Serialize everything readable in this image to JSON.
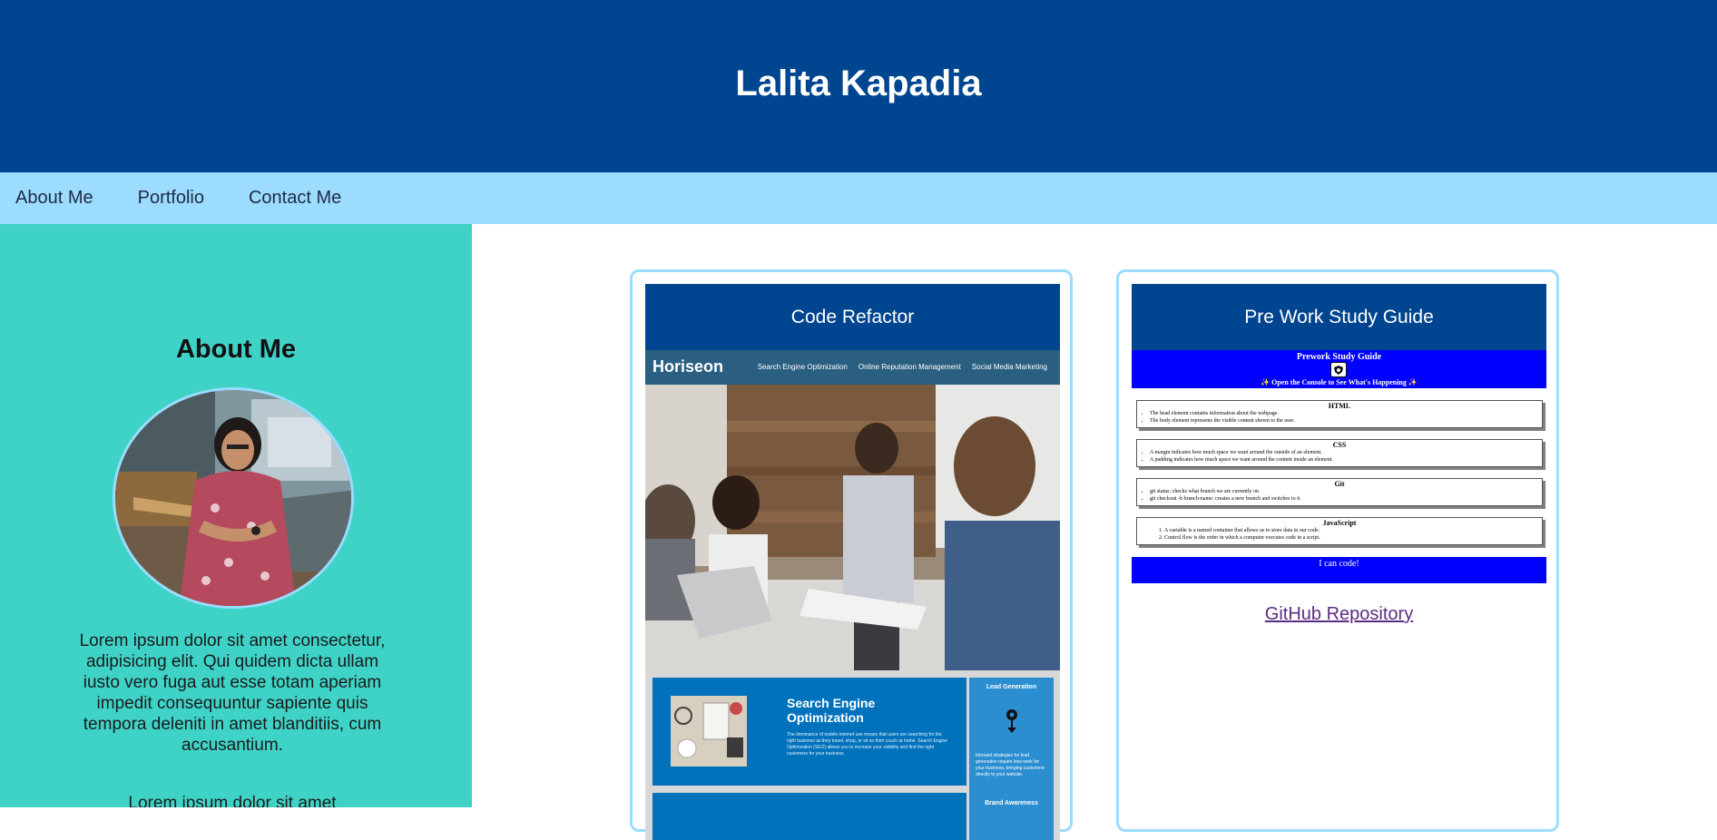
{
  "header": {
    "title": "Lalita Kapadia"
  },
  "nav": {
    "items": [
      {
        "label": "About Me"
      },
      {
        "label": "Portfolio"
      },
      {
        "label": "Contact Me"
      }
    ]
  },
  "about": {
    "heading": "About Me",
    "paragraphs": [
      "Lorem ipsum dolor sit amet consectetur, adipisicing elit. Qui quidem dicta ullam iusto vero fuga aut esse totam aperiam impedit consequuntur sapiente quis tempora deleniti in amet blanditiis, cum accusantium.",
      "Lorem ipsum dolor sit amet"
    ]
  },
  "projects": [
    {
      "title": "Code Refactor",
      "preview": {
        "logo": "Horiseon",
        "links": [
          "Search Engine Optimization",
          "Online Reputation Management",
          "Social Media Marketing"
        ],
        "seo_heading": "Search Engine Optimization",
        "seo_text": "The dominance of mobile internet use means that users are searching for the right business as they travel, shop, or sit on their couch at home. Search Engine Optimization (SEO) allows you to increase your visibility and find the right customers for your business.",
        "side_title": "Lead Generation",
        "side_text": "Inbound strategies for lead generation require less work for your business, bringing customers directly to your website.",
        "side_title_2": "Brand Awareness"
      }
    },
    {
      "title": "Pre Work Study Guide",
      "preview": {
        "heading": "Prework Study Guide",
        "subheading": "✨ Open the Console to See What's Happening ✨",
        "sections": [
          {
            "title": "HTML",
            "items": [
              "The head element contains information about the webpage.",
              "The body element represents the visible content shown to the user."
            ]
          },
          {
            "title": "CSS",
            "items": [
              "A margin indicates how much space we want around the outside of an element.",
              "A padding indicates how much space we want around the content inside an element."
            ]
          },
          {
            "title": "Git",
            "items": [
              "git status: checks what branch we are currently on",
              "git checkout -b branch-name: creates a new branch and switches to it"
            ]
          },
          {
            "title": "JavaScript",
            "items": [
              "A variable is a named container that allows us to store data in our code.",
              "Control flow is the order in which a computer executes code in a script."
            ]
          }
        ],
        "footer": "I can code!"
      },
      "link_label": "GitHub Repository"
    }
  ],
  "colors": {
    "header": "#004590",
    "nav": "#9bdcff",
    "sidebar": "#3fd3c8",
    "card_border": "#9bdcff",
    "link": "#5b2c83"
  }
}
